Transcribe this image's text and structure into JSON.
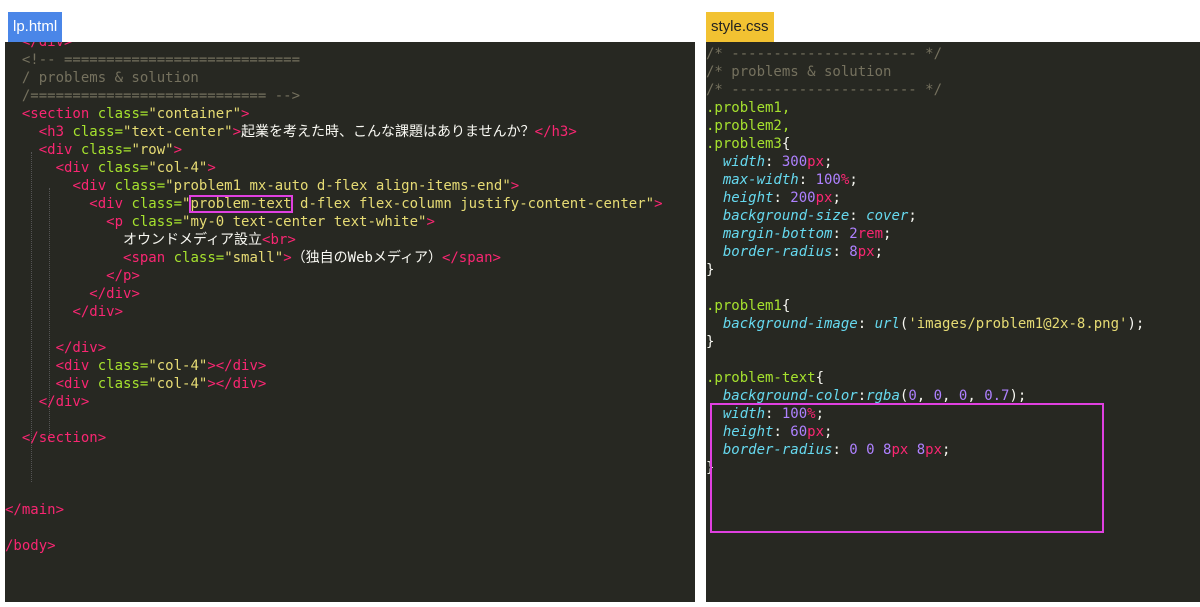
{
  "tabs": {
    "left": "lp.html",
    "right": "style.css"
  },
  "html_lines": [
    [
      {
        "c": "c-tag",
        "t": "  </div>"
      }
    ],
    [
      {
        "c": "c-cm",
        "t": "  <!-- ============================"
      }
    ],
    [
      {
        "c": "c-cm",
        "t": "  / problems & solution"
      }
    ],
    [
      {
        "c": "c-cm",
        "t": "  /============================ -->"
      }
    ],
    [
      {
        "c": "c-txt",
        "t": "  "
      },
      {
        "c": "c-tag",
        "t": "<section"
      },
      {
        "c": "c-attr",
        "t": " class="
      },
      {
        "c": "c-str",
        "t": "\"container\""
      },
      {
        "c": "c-tag",
        "t": ">"
      }
    ],
    [
      {
        "c": "c-txt",
        "t": "    "
      },
      {
        "c": "c-tag",
        "t": "<h3"
      },
      {
        "c": "c-attr",
        "t": " class="
      },
      {
        "c": "c-str",
        "t": "\"text-center\""
      },
      {
        "c": "c-tag",
        "t": ">"
      },
      {
        "c": "c-txt",
        "t": "起業を考えた時、こんな課題はありませんか？"
      },
      {
        "c": "c-tag",
        "t": "</h3>"
      }
    ],
    [
      {
        "c": "c-txt",
        "t": "    "
      },
      {
        "c": "c-tag",
        "t": "<div"
      },
      {
        "c": "c-attr",
        "t": " class="
      },
      {
        "c": "c-str",
        "t": "\"row\""
      },
      {
        "c": "c-tag",
        "t": ">"
      }
    ],
    [
      {
        "c": "c-txt",
        "t": "      "
      },
      {
        "c": "c-tag",
        "t": "<div"
      },
      {
        "c": "c-attr",
        "t": " class="
      },
      {
        "c": "c-str",
        "t": "\"col-4\""
      },
      {
        "c": "c-tag",
        "t": ">"
      }
    ],
    [
      {
        "c": "c-txt",
        "t": "        "
      },
      {
        "c": "c-tag",
        "t": "<div"
      },
      {
        "c": "c-attr",
        "t": " class="
      },
      {
        "c": "c-str",
        "t": "\"problem1 mx-auto d-flex align-items-end\""
      },
      {
        "c": "c-tag",
        "t": ">"
      }
    ],
    [
      {
        "c": "c-txt",
        "t": "          "
      },
      {
        "c": "c-tag",
        "t": "<div"
      },
      {
        "c": "c-attr",
        "t": " class="
      },
      {
        "c": "c-str",
        "t": "\""
      },
      {
        "c": "c-str hl-word",
        "t": "problem-text"
      },
      {
        "c": "c-str",
        "t": " d-flex flex-column justify-content-center\""
      },
      {
        "c": "c-tag",
        "t": ">"
      }
    ],
    [
      {
        "c": "c-txt",
        "t": "            "
      },
      {
        "c": "c-tag",
        "t": "<p"
      },
      {
        "c": "c-attr",
        "t": " class="
      },
      {
        "c": "c-str",
        "t": "\"my-0 text-center text-white\""
      },
      {
        "c": "c-tag",
        "t": ">"
      }
    ],
    [
      {
        "c": "c-txt",
        "t": "              オウンドメディア設立"
      },
      {
        "c": "c-tag",
        "t": "<br>"
      }
    ],
    [
      {
        "c": "c-txt",
        "t": "              "
      },
      {
        "c": "c-tag",
        "t": "<span"
      },
      {
        "c": "c-attr",
        "t": " class="
      },
      {
        "c": "c-str",
        "t": "\"small\""
      },
      {
        "c": "c-tag",
        "t": ">"
      },
      {
        "c": "c-txt",
        "t": "（独自のWebメディア）"
      },
      {
        "c": "c-tag",
        "t": "</span>"
      }
    ],
    [
      {
        "c": "c-txt",
        "t": "            "
      },
      {
        "c": "c-tag",
        "t": "</p>"
      }
    ],
    [
      {
        "c": "c-txt",
        "t": "          "
      },
      {
        "c": "c-tag",
        "t": "</div>"
      }
    ],
    [
      {
        "c": "c-txt",
        "t": "        "
      },
      {
        "c": "c-tag",
        "t": "</div>"
      }
    ],
    [
      {
        "c": "c-txt",
        "t": ""
      }
    ],
    [
      {
        "c": "c-txt",
        "t": "      "
      },
      {
        "c": "c-tag",
        "t": "</div>"
      }
    ],
    [
      {
        "c": "c-txt",
        "t": "      "
      },
      {
        "c": "c-tag",
        "t": "<div"
      },
      {
        "c": "c-attr",
        "t": " class="
      },
      {
        "c": "c-str",
        "t": "\"col-4\""
      },
      {
        "c": "c-tag",
        "t": "></div>"
      }
    ],
    [
      {
        "c": "c-txt",
        "t": "      "
      },
      {
        "c": "c-tag",
        "t": "<div"
      },
      {
        "c": "c-attr",
        "t": " class="
      },
      {
        "c": "c-str",
        "t": "\"col-4\""
      },
      {
        "c": "c-tag",
        "t": "></div>"
      }
    ],
    [
      {
        "c": "c-txt",
        "t": "    "
      },
      {
        "c": "c-tag",
        "t": "</div>"
      }
    ],
    [
      {
        "c": "c-txt",
        "t": ""
      }
    ],
    [
      {
        "c": "c-txt",
        "t": "  "
      },
      {
        "c": "c-tag",
        "t": "</section>"
      }
    ],
    [
      {
        "c": "c-txt",
        "t": ""
      }
    ],
    [
      {
        "c": "c-txt",
        "t": ""
      }
    ],
    [
      {
        "c": "c-txt",
        "t": ""
      }
    ],
    [
      {
        "c": "c-tag",
        "t": "</main>"
      }
    ],
    [
      {
        "c": "c-txt",
        "t": ""
      }
    ],
    [
      {
        "c": "c-tag",
        "t": "/body>"
      }
    ]
  ],
  "css_lines": [
    [
      {
        "c": "c-cm",
        "t": "/* ---------------------- */"
      }
    ],
    [
      {
        "c": "c-cm",
        "t": "/* problems & solution"
      }
    ],
    [
      {
        "c": "c-cm",
        "t": "/* ---------------------- */"
      }
    ],
    [
      {
        "c": "c-sel",
        "t": ".problem1,"
      }
    ],
    [
      {
        "c": "c-sel",
        "t": ".problem2,"
      }
    ],
    [
      {
        "c": "c-sel",
        "t": ".problem3"
      },
      {
        "c": "c-txt",
        "t": "{"
      }
    ],
    [
      {
        "c": "c-txt",
        "t": "  "
      },
      {
        "c": "c-prop",
        "t": "width"
      },
      {
        "c": "c-txt",
        "t": ": "
      },
      {
        "c": "c-num",
        "t": "300"
      },
      {
        "c": "c-unit",
        "t": "px"
      },
      {
        "c": "c-txt",
        "t": ";"
      }
    ],
    [
      {
        "c": "c-txt",
        "t": "  "
      },
      {
        "c": "c-prop",
        "t": "max-width"
      },
      {
        "c": "c-txt",
        "t": ": "
      },
      {
        "c": "c-num",
        "t": "100"
      },
      {
        "c": "c-unit",
        "t": "%"
      },
      {
        "c": "c-txt",
        "t": ";"
      }
    ],
    [
      {
        "c": "c-txt",
        "t": "  "
      },
      {
        "c": "c-prop",
        "t": "height"
      },
      {
        "c": "c-txt",
        "t": ": "
      },
      {
        "c": "c-num",
        "t": "200"
      },
      {
        "c": "c-unit",
        "t": "px"
      },
      {
        "c": "c-txt",
        "t": ";"
      }
    ],
    [
      {
        "c": "c-txt",
        "t": "  "
      },
      {
        "c": "c-prop",
        "t": "background-size"
      },
      {
        "c": "c-txt",
        "t": ": "
      },
      {
        "c": "c-prop",
        "t": "cover"
      },
      {
        "c": "c-txt",
        "t": ";"
      }
    ],
    [
      {
        "c": "c-txt",
        "t": "  "
      },
      {
        "c": "c-prop",
        "t": "margin-bottom"
      },
      {
        "c": "c-txt",
        "t": ": "
      },
      {
        "c": "c-num",
        "t": "2"
      },
      {
        "c": "c-unit",
        "t": "rem"
      },
      {
        "c": "c-txt",
        "t": ";"
      }
    ],
    [
      {
        "c": "c-txt",
        "t": "  "
      },
      {
        "c": "c-prop",
        "t": "border-radius"
      },
      {
        "c": "c-txt",
        "t": ": "
      },
      {
        "c": "c-num",
        "t": "8"
      },
      {
        "c": "c-unit",
        "t": "px"
      },
      {
        "c": "c-txt",
        "t": ";"
      }
    ],
    [
      {
        "c": "c-txt",
        "t": "}"
      }
    ],
    [
      {
        "c": "c-txt",
        "t": ""
      }
    ],
    [
      {
        "c": "c-sel",
        "t": ".problem1"
      },
      {
        "c": "c-txt",
        "t": "{"
      }
    ],
    [
      {
        "c": "c-txt",
        "t": "  "
      },
      {
        "c": "c-prop",
        "t": "background-image"
      },
      {
        "c": "c-txt",
        "t": ": "
      },
      {
        "c": "c-prop",
        "t": "url"
      },
      {
        "c": "c-txt",
        "t": "("
      },
      {
        "c": "c-url",
        "t": "'images/problem1@2x-8.png'"
      },
      {
        "c": "c-txt",
        "t": ");"
      }
    ],
    [
      {
        "c": "c-txt",
        "t": "}"
      }
    ],
    [
      {
        "c": "c-txt",
        "t": ""
      }
    ],
    [
      {
        "c": "c-sel",
        "t": ".problem-text"
      },
      {
        "c": "c-txt",
        "t": "{"
      }
    ],
    [
      {
        "c": "c-txt",
        "t": "  "
      },
      {
        "c": "c-prop",
        "t": "background-color"
      },
      {
        "c": "c-txt",
        "t": ":"
      },
      {
        "c": "c-prop",
        "t": "rgba"
      },
      {
        "c": "c-txt",
        "t": "("
      },
      {
        "c": "c-num",
        "t": "0"
      },
      {
        "c": "c-txt",
        "t": ", "
      },
      {
        "c": "c-num",
        "t": "0"
      },
      {
        "c": "c-txt",
        "t": ", "
      },
      {
        "c": "c-num",
        "t": "0"
      },
      {
        "c": "c-txt",
        "t": ", "
      },
      {
        "c": "c-num",
        "t": "0.7"
      },
      {
        "c": "c-txt",
        "t": ");"
      }
    ],
    [
      {
        "c": "c-txt",
        "t": "  "
      },
      {
        "c": "c-prop",
        "t": "width"
      },
      {
        "c": "c-txt",
        "t": ": "
      },
      {
        "c": "c-num",
        "t": "100"
      },
      {
        "c": "c-unit",
        "t": "%"
      },
      {
        "c": "c-txt",
        "t": ";"
      }
    ],
    [
      {
        "c": "c-txt",
        "t": "  "
      },
      {
        "c": "c-prop",
        "t": "height"
      },
      {
        "c": "c-txt",
        "t": ": "
      },
      {
        "c": "c-num",
        "t": "60"
      },
      {
        "c": "c-unit",
        "t": "px"
      },
      {
        "c": "c-txt",
        "t": ";"
      }
    ],
    [
      {
        "c": "c-txt",
        "t": "  "
      },
      {
        "c": "c-prop",
        "t": "border-radius"
      },
      {
        "c": "c-txt",
        "t": ": "
      },
      {
        "c": "c-num",
        "t": "0 0 8"
      },
      {
        "c": "c-unit",
        "t": "px"
      },
      {
        "c": "c-num",
        "t": " 8"
      },
      {
        "c": "c-unit",
        "t": "px"
      },
      {
        "c": "c-txt",
        "t": ";"
      }
    ],
    [
      {
        "c": "c-txt",
        "t": "}"
      }
    ]
  ],
  "colors": {
    "editor_bg": "#272822",
    "highlight": "#e040e0",
    "tab_left": "#4a86e8",
    "tab_right": "#f2c232"
  }
}
